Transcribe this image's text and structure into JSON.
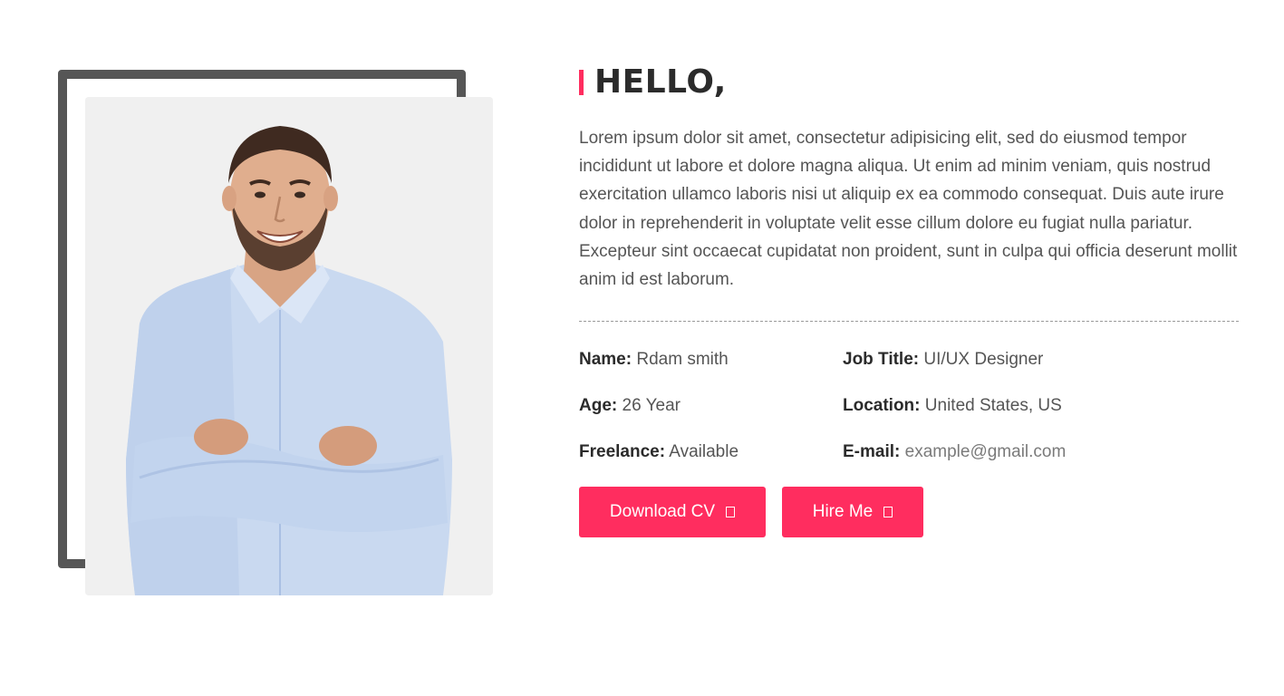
{
  "heading": "HELLO,",
  "bio": "Lorem ipsum dolor sit amet, consectetur adipisicing elit, sed do eiusmod tempor incididunt ut labore et dolore magna aliqua. Ut enim ad minim veniam, quis nostrud exercitation ullamco laboris nisi ut aliquip ex ea commodo consequat. Duis aute irure dolor in reprehenderit in voluptate velit esse cillum dolore eu fugiat nulla pariatur. Excepteur sint occaecat cupidatat non proident, sunt in culpa qui officia deserunt mollit anim id est laborum.",
  "info": {
    "name": {
      "label": "Name:",
      "value": "Rdam smith"
    },
    "job_title": {
      "label": "Job Title:",
      "value": "UI/UX Designer"
    },
    "age": {
      "label": "Age:",
      "value": "26 Year"
    },
    "location": {
      "label": "Location:",
      "value": "United States, US"
    },
    "freelance": {
      "label": "Freelance:",
      "value": "Available"
    },
    "email": {
      "label": "E-mail:",
      "value": "example@gmail.com"
    }
  },
  "buttons": {
    "download_cv": {
      "label": "Download CV",
      "icon": "download-icon"
    },
    "hire_me": {
      "label": "Hire Me",
      "icon": "send-icon"
    }
  },
  "colors": {
    "accent": "#ff2d5f",
    "frame": "#565656",
    "photo_bg": "#f0f0f0",
    "heading": "#2b2b2b",
    "text": "#555555"
  }
}
